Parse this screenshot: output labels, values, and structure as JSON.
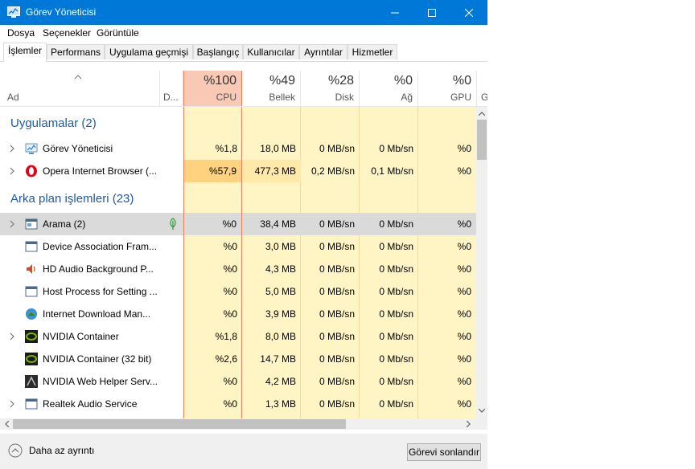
{
  "window": {
    "title": "Görev Yöneticisi"
  },
  "menu": [
    "Dosya",
    "Seçenekler",
    "Görüntüle"
  ],
  "tabs": [
    "İşlemler",
    "Performans",
    "Uygulama geçmişi",
    "Başlangıç",
    "Kullanıcılar",
    "Ayrıntılar",
    "Hizmetler"
  ],
  "columns": {
    "name": "Ad",
    "status": "D...",
    "cpu": {
      "pct": "%100",
      "label": "CPU"
    },
    "mem": {
      "pct": "%49",
      "label": "Bellek"
    },
    "disk": {
      "pct": "%28",
      "label": "Disk"
    },
    "net": {
      "pct": "%0",
      "label": "Ağ"
    },
    "gpu": {
      "pct": "%0",
      "label": "GPU"
    },
    "extra": "G"
  },
  "groups": {
    "apps": "Uygulamalar (2)",
    "background": "Arka plan işlemleri (23)"
  },
  "processes": [
    {
      "name": "Görev Yöneticisi",
      "cpu": "%1,8",
      "mem": "18,0 MB",
      "disk": "0 MB/sn",
      "net": "0 Mb/sn",
      "gpu": "%0"
    },
    {
      "name": "Opera Internet Browser (...",
      "cpu": "%57,9",
      "mem": "477,3 MB",
      "disk": "0,2 MB/sn",
      "net": "0,1 Mb/sn",
      "gpu": "%0"
    },
    {
      "name": "Arama (2)",
      "cpu": "%0",
      "mem": "38,4 MB",
      "disk": "0 MB/sn",
      "net": "0 Mb/sn",
      "gpu": "%0"
    },
    {
      "name": "Device Association Fram...",
      "cpu": "%0",
      "mem": "3,0 MB",
      "disk": "0 MB/sn",
      "net": "0 Mb/sn",
      "gpu": "%0"
    },
    {
      "name": "HD Audio Background P...",
      "cpu": "%0",
      "mem": "4,3 MB",
      "disk": "0 MB/sn",
      "net": "0 Mb/sn",
      "gpu": "%0"
    },
    {
      "name": "Host Process for Setting ...",
      "cpu": "%0",
      "mem": "5,0 MB",
      "disk": "0 MB/sn",
      "net": "0 Mb/sn",
      "gpu": "%0"
    },
    {
      "name": "Internet Download Man...",
      "cpu": "%0",
      "mem": "3,9 MB",
      "disk": "0 MB/sn",
      "net": "0 Mb/sn",
      "gpu": "%0"
    },
    {
      "name": "NVIDIA Container",
      "cpu": "%1,8",
      "mem": "8,0 MB",
      "disk": "0 MB/sn",
      "net": "0 Mb/sn",
      "gpu": "%0"
    },
    {
      "name": "NVIDIA Container (32 bit)",
      "cpu": "%2,6",
      "mem": "14,7 MB",
      "disk": "0 MB/sn",
      "net": "0 Mb/sn",
      "gpu": "%0"
    },
    {
      "name": "NVIDIA Web Helper Serv...",
      "cpu": "%0",
      "mem": "4,2 MB",
      "disk": "0 MB/sn",
      "net": "0 Mb/sn",
      "gpu": "%0"
    },
    {
      "name": "Realtek Audio Service",
      "cpu": "%0",
      "mem": "1,3 MB",
      "disk": "0 MB/sn",
      "net": "0 Mb/sn",
      "gpu": "%0"
    }
  ],
  "footer": {
    "less_details": "Daha az ayrıntı",
    "end_task": "Görevi sonlandır"
  },
  "colors": {
    "title_bar": "#0078d7",
    "group_title": "#1f5aa6",
    "cell_light": "#fff4c4",
    "cell_cpu_high": "#ffd27f",
    "cpu_header": "#f9c9b6",
    "selected_row": "#dadada",
    "cpu_column_border": "#e8805c"
  }
}
